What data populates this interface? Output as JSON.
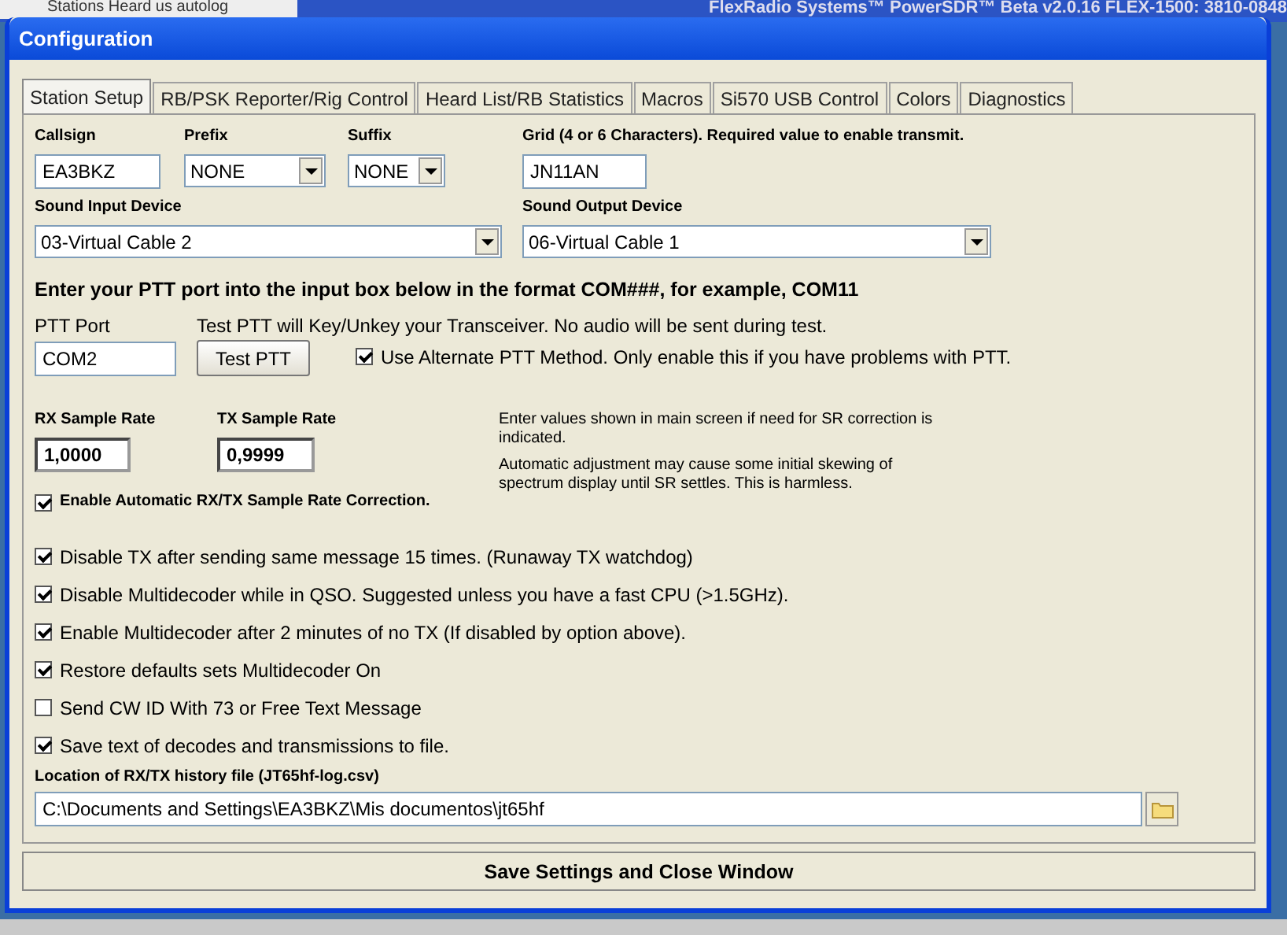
{
  "background": {
    "left_window_title": "Stations Heard us autolog",
    "main_window_title": "FlexRadio Systems™  PowerSDR™  Beta  v2.0.16   FLEX-1500:  3810-0848"
  },
  "window": {
    "title": "Configuration"
  },
  "tabs": [
    {
      "label": "Station Setup",
      "selected": true
    },
    {
      "label": "RB/PSK Reporter/Rig Control",
      "selected": false
    },
    {
      "label": "Heard List/RB Statistics",
      "selected": false
    },
    {
      "label": "Macros",
      "selected": false
    },
    {
      "label": "Si570 USB Control",
      "selected": false
    },
    {
      "label": "Colors",
      "selected": false
    },
    {
      "label": "Diagnostics",
      "selected": false
    }
  ],
  "station": {
    "callsign": {
      "label": "Callsign",
      "value": "EA3BKZ"
    },
    "prefix": {
      "label": "Prefix",
      "value": "NONE"
    },
    "suffix": {
      "label": "Suffix",
      "value": "NONE"
    },
    "grid": {
      "label": "Grid (4 or 6 Characters).  Required value to enable transmit.",
      "value": "JN11AN"
    }
  },
  "sound": {
    "input": {
      "label": "Sound Input Device",
      "value": "03-Virtual Cable 2"
    },
    "output": {
      "label": "Sound Output Device",
      "value": "06-Virtual Cable 1"
    }
  },
  "ptt": {
    "instruction": "Enter your PTT port into the input box below in the format COM###, for example, COM11",
    "port_label": "PTT Port",
    "port_value": "COM2",
    "test_note": "Test PTT will Key/Unkey your Transceiver.  No audio will be sent during test.",
    "test_button": "Test PTT",
    "alternate": {
      "label": "Use Alternate PTT Method.  Only enable this if you have problems with PTT.",
      "checked": true
    }
  },
  "sample_rate": {
    "rx": {
      "label": "RX Sample Rate",
      "value": "1,0000"
    },
    "tx": {
      "label": "TX Sample Rate",
      "value": "0,9999"
    },
    "note_1": "Enter values shown in main screen if need for SR correction is indicated.",
    "note_2": "Automatic adjustment may cause some initial skewing of spectrum display until SR settles.  This is harmless.",
    "auto": {
      "label": "Enable Automatic RX/TX Sample Rate Correction.",
      "checked": true
    }
  },
  "options": [
    {
      "label": "Disable TX after sending same message 15 times.  (Runaway TX watchdog)",
      "checked": true
    },
    {
      "label": "Disable Multidecoder while in QSO.  Suggested unless you have a fast CPU (>1.5GHz).",
      "checked": true
    },
    {
      "label": "Enable Multidecoder after 2 minutes of no TX (If disabled by option above).",
      "checked": true
    },
    {
      "label": "Restore defaults sets Multidecoder On",
      "checked": true
    },
    {
      "label": "Send CW ID With 73 or Free Text Message",
      "checked": false
    },
    {
      "label": "Save text of decodes and transmissions to file.",
      "checked": true
    }
  ],
  "history": {
    "label": "Location of RX/TX history file (JT65hf-log.csv)",
    "value": "C:\\Documents and Settings\\EA3BKZ\\Mis documentos\\jt65hf"
  },
  "save_button": "Save Settings and Close Window"
}
